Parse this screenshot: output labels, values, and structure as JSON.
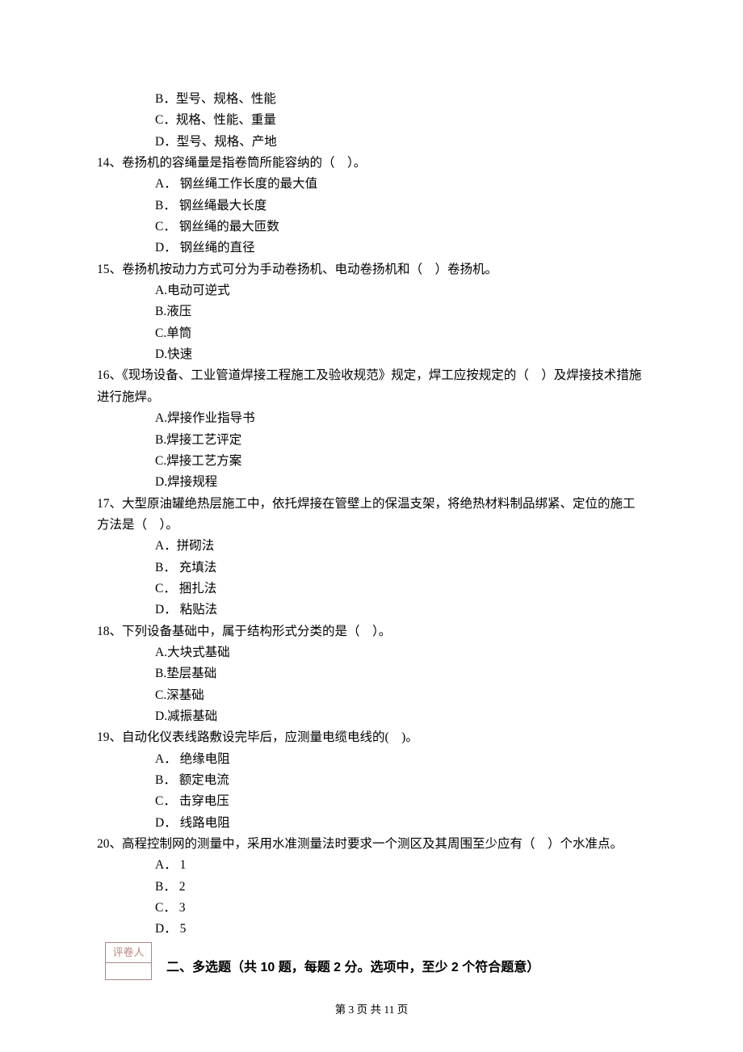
{
  "q13_extra": {
    "options": [
      {
        "letter": "B",
        "text": "型号、规格、性能"
      },
      {
        "letter": "C",
        "text": "规格、性能、重量"
      },
      {
        "letter": "D",
        "text": "型号、规格、产地"
      }
    ]
  },
  "questions": [
    {
      "num": "14",
      "stem": "卷扬机的容绳量是指卷筒所能容纳的（    ）。",
      "options": [
        {
          "letter": "A",
          "text": "钢丝绳工作长度的最大值"
        },
        {
          "letter": "B",
          "text": "钢丝绳最大长度"
        },
        {
          "letter": "C",
          "text": "钢丝绳的最大匝数"
        },
        {
          "letter": "D",
          "text": "钢丝绳的直径"
        }
      ],
      "sep": "．"
    },
    {
      "num": "15",
      "stem": "卷扬机按动力方式可分为手动卷扬机、电动卷扬机和（    ）卷扬机。",
      "options": [
        {
          "letter": "A",
          "text": "电动可逆式"
        },
        {
          "letter": "B",
          "text": "液压"
        },
        {
          "letter": "C",
          "text": "单筒"
        },
        {
          "letter": "D",
          "text": "快速"
        }
      ],
      "sep": "."
    },
    {
      "num": "16",
      "stem": "《现场设备、工业管道焊接工程施工及验收规范》规定，焊工应按规定的（    ）及焊接技术措施进行施焊。",
      "options": [
        {
          "letter": "A",
          "text": "焊接作业指导书"
        },
        {
          "letter": "B",
          "text": "焊接工艺评定"
        },
        {
          "letter": "C",
          "text": "焊接工艺方案"
        },
        {
          "letter": "D",
          "text": "焊接规程"
        }
      ],
      "sep": "."
    },
    {
      "num": "17",
      "stem": "大型原油罐绝热层施工中，依托焊接在管壁上的保温支架，将绝热材料制品绑紧、定位的施工方法是（    ）。",
      "options": [
        {
          "letter": "A",
          "text": "拼砌法"
        },
        {
          "letter": "B",
          "text": "充填法"
        },
        {
          "letter": "C",
          "text": "捆扎法"
        },
        {
          "letter": "D",
          "text": "粘贴法"
        }
      ],
      "sep": "．"
    },
    {
      "num": "18",
      "stem": "下列设备基础中，属于结构形式分类的是（    ）。",
      "options": [
        {
          "letter": "A",
          "text": "大块式基础"
        },
        {
          "letter": "B",
          "text": "垫层基础"
        },
        {
          "letter": "C",
          "text": "深基础"
        },
        {
          "letter": "D",
          "text": "减振基础"
        }
      ],
      "sep": "."
    },
    {
      "num": "19",
      "stem": "自动化仪表线路敷设完毕后，应测量电缆电线的(    )。",
      "options": [
        {
          "letter": "A",
          "text": "绝缘电阻"
        },
        {
          "letter": "B",
          "text": "额定电流"
        },
        {
          "letter": "C",
          "text": "击穿电压"
        },
        {
          "letter": "D",
          "text": "线路电阻"
        }
      ],
      "sep": "．"
    },
    {
      "num": "20",
      "stem": "高程控制网的测量中，采用水准测量法时要求一个测区及其周围至少应有（    ）个水准点。",
      "options": [
        {
          "letter": "A",
          "text": "1"
        },
        {
          "letter": "B",
          "text": "2"
        },
        {
          "letter": "C",
          "text": "3"
        },
        {
          "letter": "D",
          "text": "5"
        }
      ],
      "sep": "．"
    }
  ],
  "grader_label": "评卷人",
  "section2_heading": "二、多选题（共 10 题，每题 2 分。选项中，至少 2 个符合题意）",
  "footer": "第 3 页 共 11 页"
}
